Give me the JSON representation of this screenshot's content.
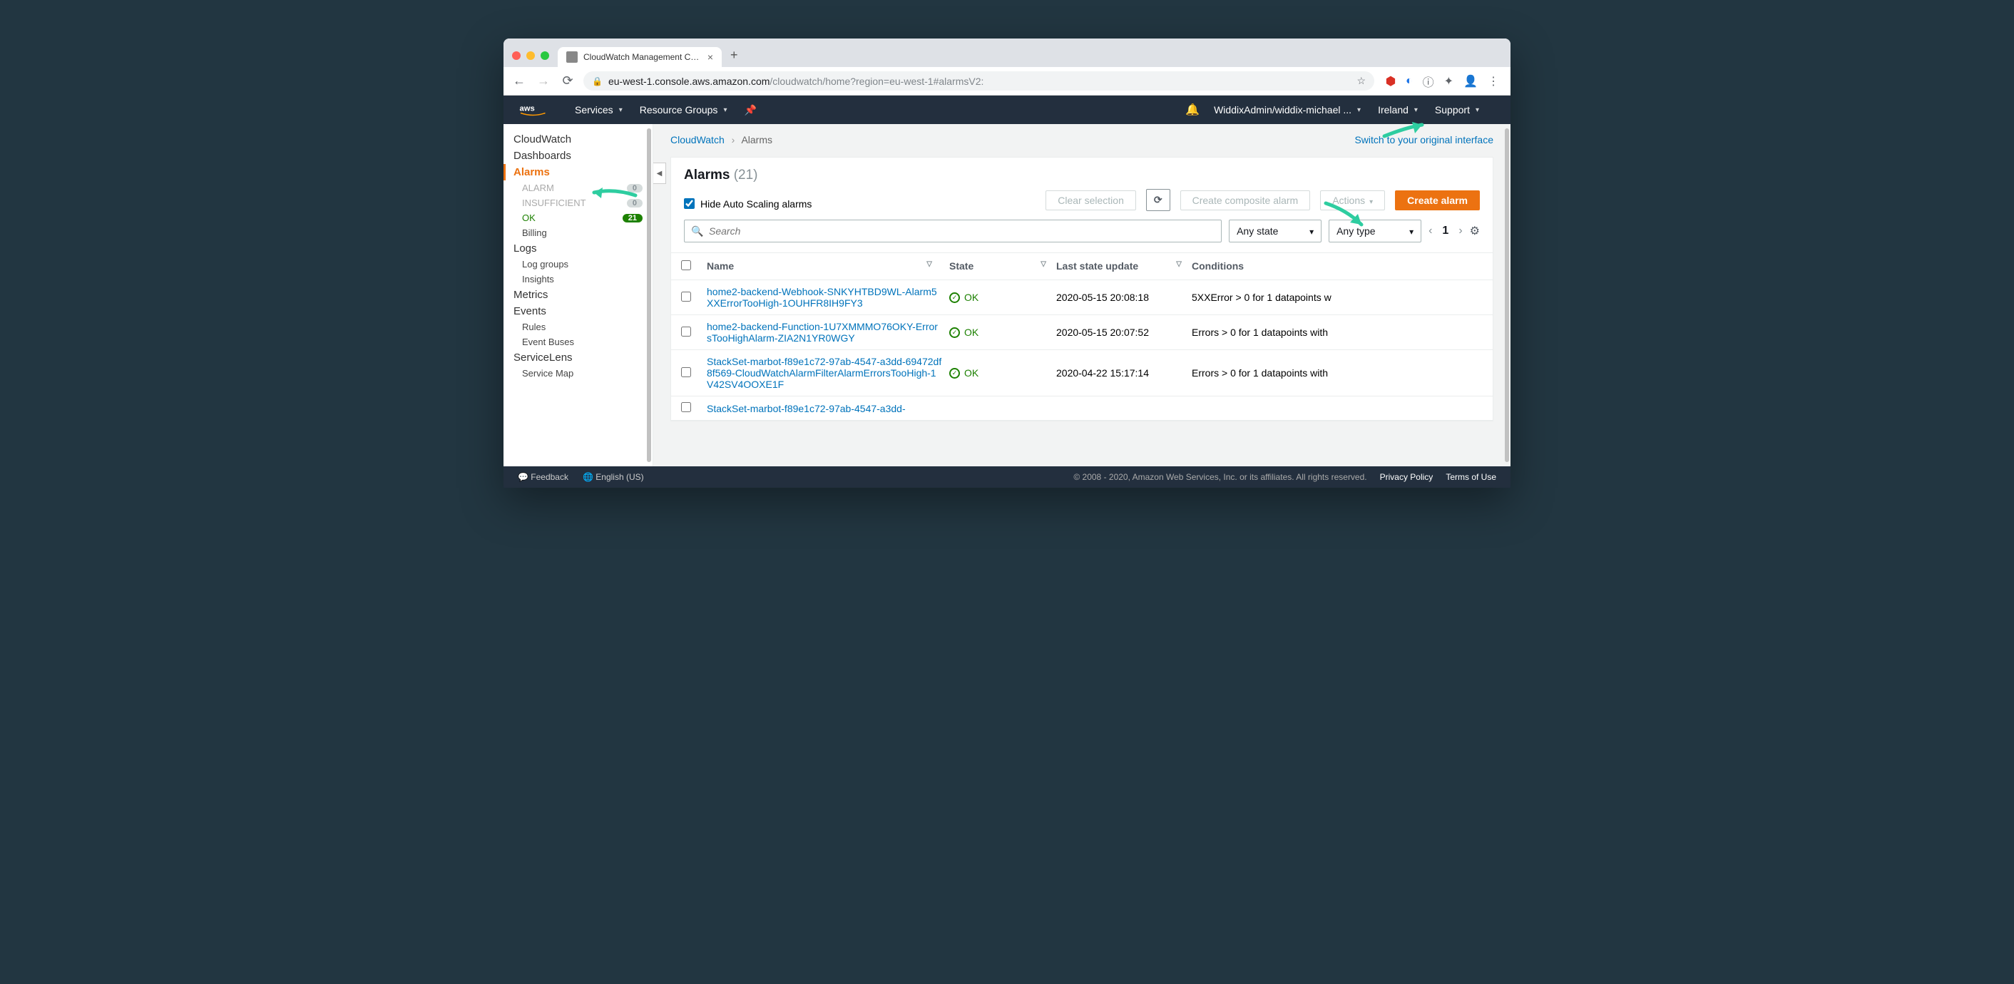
{
  "browser": {
    "tab_title": "CloudWatch Management Cons",
    "url_host": "eu-west-1.console.aws.amazon.com",
    "url_path": "/cloudwatch/home?region=eu-west-1#alarmsV2:"
  },
  "nav": {
    "services": "Services",
    "resource_groups": "Resource Groups",
    "account": "WiddixAdmin/widdix-michael ...",
    "region": "Ireland",
    "support": "Support"
  },
  "sidebar": {
    "items": [
      {
        "label": "CloudWatch",
        "type": "section"
      },
      {
        "label": "Dashboards",
        "type": "section"
      },
      {
        "label": "Alarms",
        "type": "section",
        "selected": true
      },
      {
        "label": "ALARM",
        "type": "sub",
        "dim": true,
        "badge": "0"
      },
      {
        "label": "INSUFFICIENT",
        "type": "sub",
        "dim": true,
        "badge": "0"
      },
      {
        "label": "OK",
        "type": "sub",
        "ok": true,
        "badge": "21",
        "badge_green": true
      },
      {
        "label": "Billing",
        "type": "sub"
      },
      {
        "label": "Logs",
        "type": "section"
      },
      {
        "label": "Log groups",
        "type": "sub"
      },
      {
        "label": "Insights",
        "type": "sub"
      },
      {
        "label": "Metrics",
        "type": "section"
      },
      {
        "label": "Events",
        "type": "section"
      },
      {
        "label": "Rules",
        "type": "sub"
      },
      {
        "label": "Event Buses",
        "type": "sub"
      },
      {
        "label": "ServiceLens",
        "type": "section"
      },
      {
        "label": "Service Map",
        "type": "sub"
      }
    ]
  },
  "breadcrumb": {
    "root": "CloudWatch",
    "current": "Alarms",
    "switch": "Switch to your original interface"
  },
  "panel": {
    "title": "Alarms",
    "count": "(21)",
    "hide_autoscale": "Hide Auto Scaling alarms",
    "clear_selection": "Clear selection",
    "create_composite": "Create composite alarm",
    "actions": "Actions",
    "create_alarm": "Create alarm",
    "search_placeholder": "Search",
    "any_state": "Any state",
    "any_type": "Any type",
    "page": "1"
  },
  "table": {
    "headers": {
      "name": "Name",
      "state": "State",
      "update": "Last state update",
      "cond": "Conditions"
    },
    "rows": [
      {
        "name": "home2-backend-Webhook-SNKYHTBD9WL-Alarm5XXErrorTooHigh-1OUHFR8IH9FY3",
        "state": "OK",
        "update": "2020-05-15 20:08:18",
        "cond": "5XXError > 0 for 1 datapoints w"
      },
      {
        "name": "home2-backend-Function-1U7XMMMO76OKY-ErrorsTooHighAlarm-ZIA2N1YR0WGY",
        "state": "OK",
        "update": "2020-05-15 20:07:52",
        "cond": "Errors > 0 for 1 datapoints with"
      },
      {
        "name": "StackSet-marbot-f89e1c72-97ab-4547-a3dd-69472df8f569-CloudWatchAlarmFilterAlarmErrorsTooHigh-1V42SV4OOXE1F",
        "state": "OK",
        "update": "2020-04-22 15:17:14",
        "cond": "Errors > 0 for 1 datapoints with"
      },
      {
        "name": "StackSet-marbot-f89e1c72-97ab-4547-a3dd-",
        "state": "",
        "update": "",
        "cond": ""
      }
    ]
  },
  "footer": {
    "feedback": "Feedback",
    "lang": "English (US)",
    "copyright": "© 2008 - 2020, Amazon Web Services, Inc. or its affiliates. All rights reserved.",
    "privacy": "Privacy Policy",
    "terms": "Terms of Use"
  }
}
